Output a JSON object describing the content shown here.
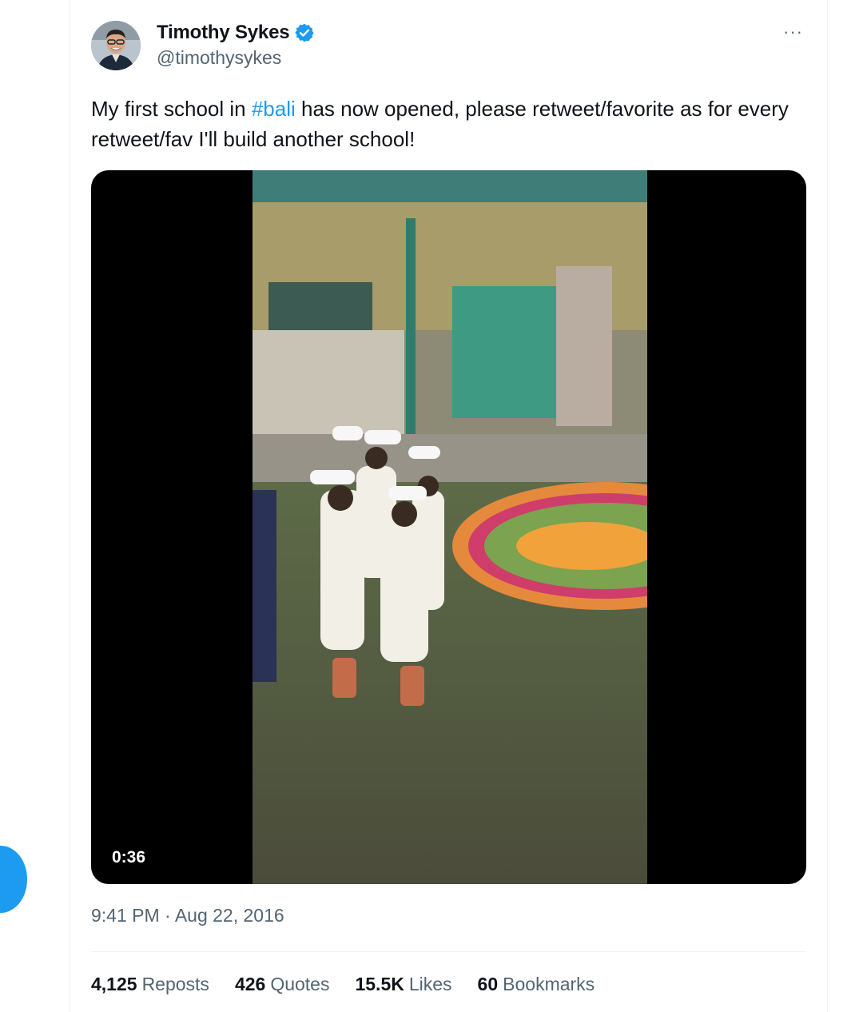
{
  "author": {
    "display_name": "Timothy Sykes",
    "handle": "@timothysykes",
    "verified": true,
    "avatar_icon": "profile-photo"
  },
  "menu": {
    "more_label": "···"
  },
  "tweet": {
    "text_before": "My first school in ",
    "hashtag": "#bali",
    "text_after": " has now opened, please retweet/favorite as for every retweet/fav I'll build another school!"
  },
  "media": {
    "type": "video",
    "duration": "0:36"
  },
  "timestamp": "9:41 PM · Aug 22, 2016",
  "stats": [
    {
      "value": "4,125",
      "label": "Reposts"
    },
    {
      "value": "426",
      "label": "Quotes"
    },
    {
      "value": "15.5K",
      "label": "Likes"
    },
    {
      "value": "60",
      "label": "Bookmarks"
    }
  ],
  "colors": {
    "accent": "#1d9bf0",
    "text": "#0f1419",
    "secondary": "#536471"
  }
}
